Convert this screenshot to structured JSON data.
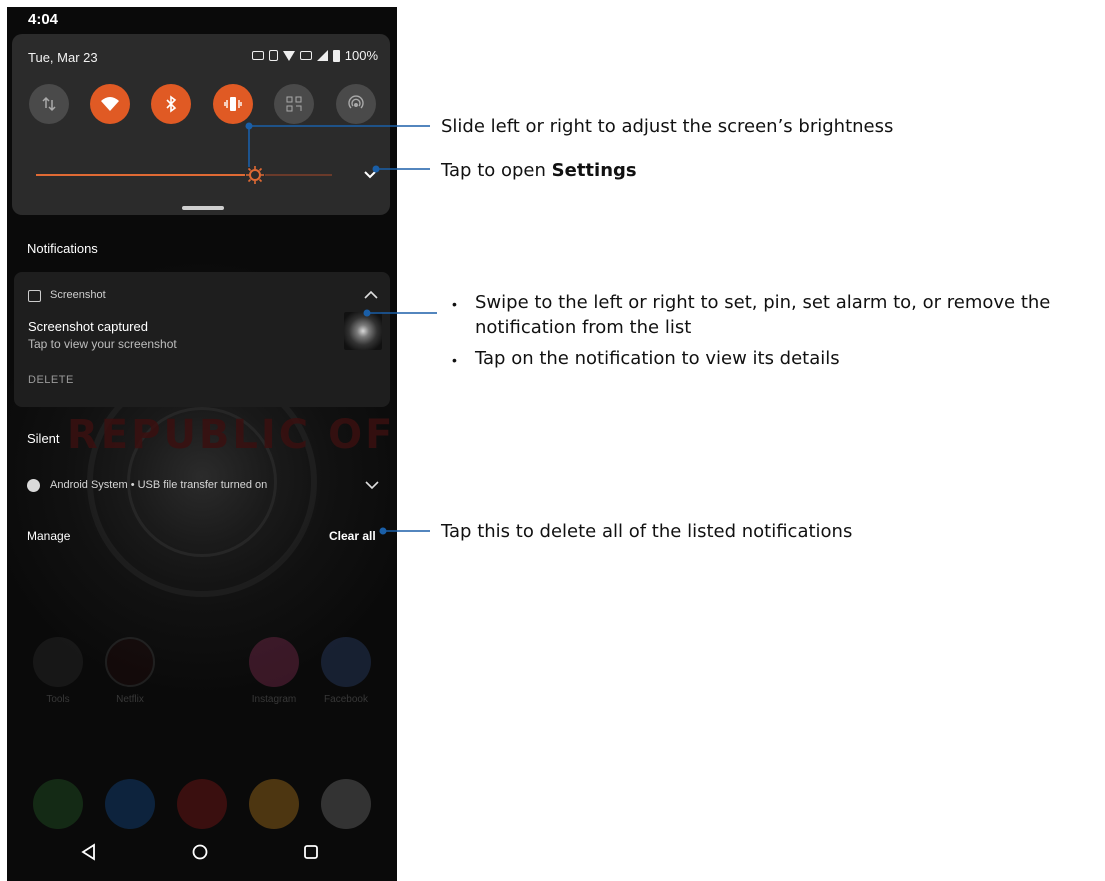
{
  "status_bar": {
    "time": "4:04"
  },
  "quick_settings": {
    "date": "Tue, Mar 23",
    "battery": "100%",
    "tiles": [
      {
        "name": "mobile-data-tile",
        "icon": "data-arrows-icon",
        "state": "off"
      },
      {
        "name": "wifi-tile",
        "icon": "wifi-icon",
        "state": "on"
      },
      {
        "name": "bluetooth-tile",
        "icon": "bluetooth-icon",
        "state": "on"
      },
      {
        "name": "vibrate-tile",
        "icon": "vibrate-icon",
        "state": "on"
      },
      {
        "name": "qr-scan-tile",
        "icon": "qr-code-icon",
        "state": "off"
      },
      {
        "name": "nfc-tile",
        "icon": "nfc-icon",
        "state": "off"
      }
    ],
    "brightness_level": 0.74,
    "accent_color": "#e05a24"
  },
  "notifications": {
    "heading": "Notifications",
    "screenshot_card": {
      "app_name": "Screenshot",
      "title": "Screenshot captured",
      "text": "Tap to view your screenshot",
      "action": "DELETE"
    },
    "silent_heading": "Silent",
    "system_row": "Android System • USB file transfer turned on",
    "manage_label": "Manage",
    "clear_all_label": "Clear all"
  },
  "home_apps": [
    "Tools",
    "Netflix",
    "Instagram",
    "Facebook"
  ],
  "wallpaper_text": "REPUBLIC OF",
  "annotations": {
    "brightness": "Slide left or right to adjust the screen’s brightness",
    "settings_prefix": "Tap to open ",
    "settings_bold": "Settings",
    "swipe_line1": "Swipe to the left or right to set, pin, set alarm to, or remove the",
    "swipe_line2": "notification from the list",
    "tap_details": "Tap on the notification to view its details",
    "clear_all": "Tap this to delete all of the listed notifications",
    "bullet": "•",
    "line_color": "#1a5fa8"
  }
}
